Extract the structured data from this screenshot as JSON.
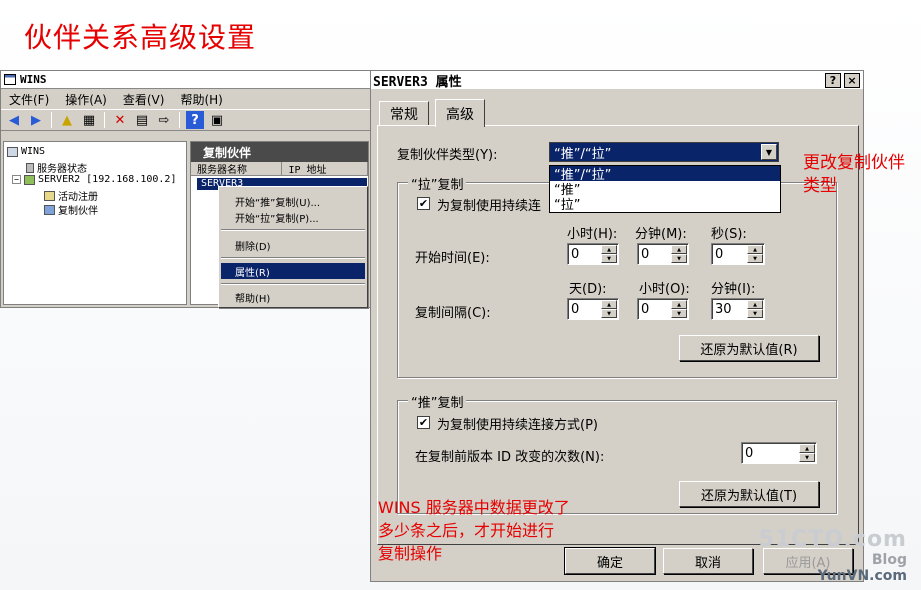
{
  "slide": {
    "title": "伙伴关系高级设置",
    "annotation_right": [
      "更改复制伙伴",
      "类型"
    ],
    "annotation_bottom": [
      "WINS 服务器中数据更改了",
      "多少条之后，才开始进行",
      "复制操作"
    ],
    "watermark_site": "51CTO.com",
    "watermark_blog": "Blog",
    "watermark_bottom": "YunVN.com"
  },
  "mmc": {
    "title": "WINS",
    "menu": [
      "文件(F)",
      "操作(A)",
      "查看(V)",
      "帮助(H)"
    ],
    "tree": {
      "root": "WINS",
      "server_status": "服务器状态",
      "server": "SERVER2 [192.168.100.2]",
      "active_registrations": "活动注册",
      "replication_partners": "复制伙伴"
    },
    "right_header": "复制伙伴",
    "columns": [
      "服务器名称",
      "IP 地址"
    ],
    "selected_row": "SERVER3",
    "context_menu": {
      "start_push": "开始“推”复制(U)...",
      "start_pull": "开始“拉”复制(P)...",
      "delete": "删除(D)",
      "properties": "属性(R)",
      "help": "帮助(H)"
    }
  },
  "dialog": {
    "title": "SERVER3 属性",
    "help_btn": "?",
    "close_btn": "×",
    "tabs": [
      "常规",
      "高级"
    ],
    "partner_type_label": "复制伙伴类型(Y):",
    "partner_type_value": "“推”/“拉”",
    "partner_type_options": [
      "“推”/“拉”",
      "“推”",
      "“拉”"
    ],
    "pull": {
      "group_label": "“拉”复制",
      "persistent_label": "为复制使用持续连",
      "persistent_checked": "✔",
      "hours_label": "小时(H):",
      "minutes_label": "分钟(M):",
      "seconds_label": "秒(S):",
      "start_time_label": "开始时间(E):",
      "start_hours": "0",
      "start_minutes": "0",
      "start_seconds": "0",
      "days_label": "天(D):",
      "hours2_label": "小时(O):",
      "minutes2_label": "分钟(I):",
      "interval_label": "复制间隔(C):",
      "interval_days": "0",
      "interval_hours": "0",
      "interval_minutes": "30",
      "restore_btn": "还原为默认值(R)"
    },
    "push": {
      "group_label": "“推”复制",
      "persistent_label": "为复制使用持续连接方式(P)",
      "persistent_checked": "✔",
      "version_label": "在复制前版本 ID 改变的次数(N):",
      "version_value": "0",
      "restore_btn": "还原为默认值(T)"
    },
    "ok_btn": "确定",
    "cancel_btn": "取消",
    "apply_btn": "应用(A)"
  }
}
